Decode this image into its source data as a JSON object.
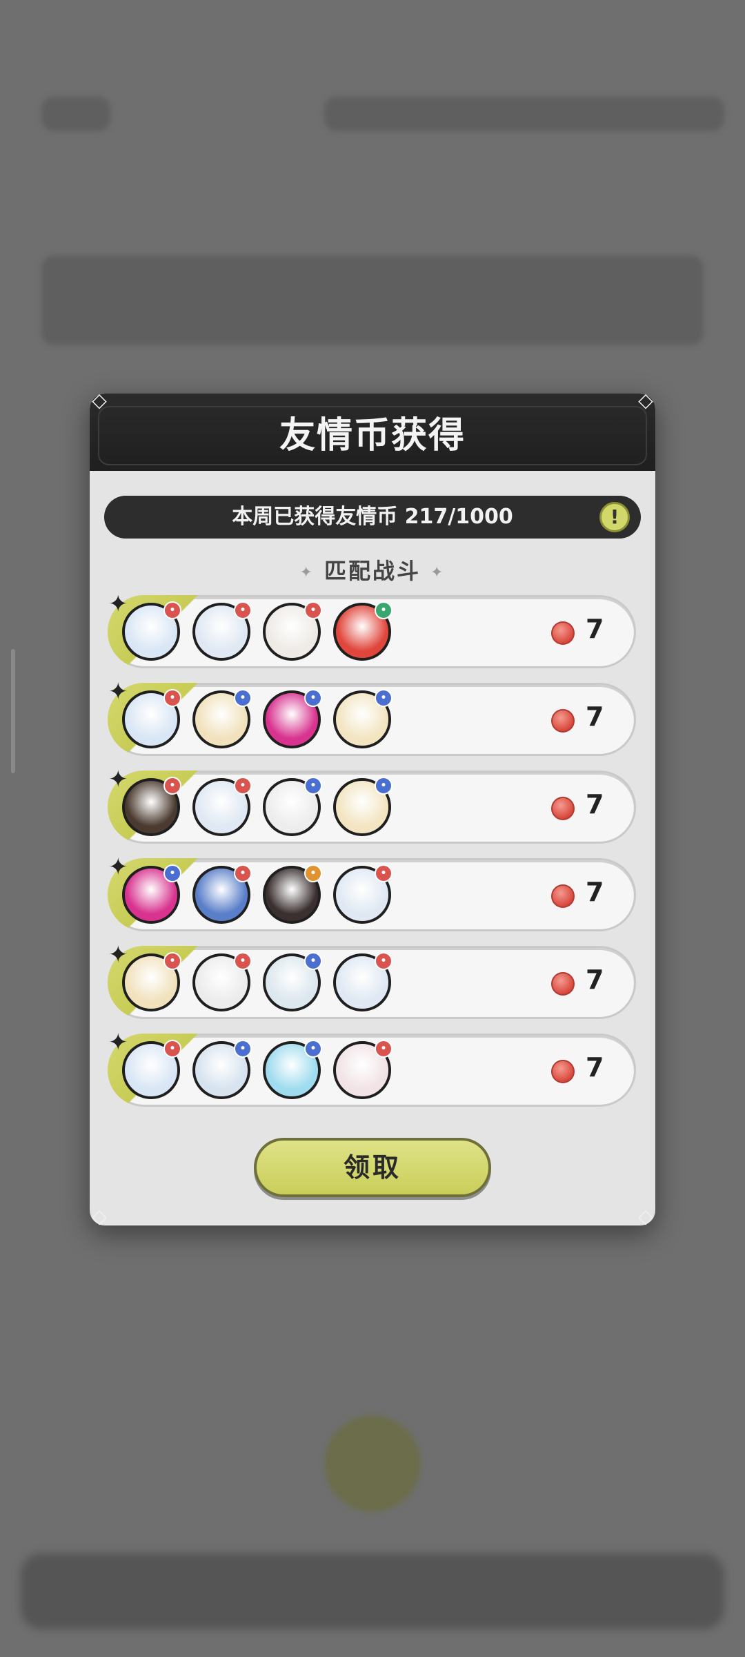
{
  "modal": {
    "title": "友情币获得",
    "weekly_text": "本周已获得友情币 217/1000",
    "info_icon": "exclamation-icon",
    "section_title": "匹配战斗",
    "claim_label": "领取",
    "rows": [
      {
        "amount": "7",
        "avatars": [
          {
            "color": "#d9e6f5",
            "badge": "#d9534f"
          },
          {
            "color": "#dfe8f3",
            "badge": "#d9534f"
          },
          {
            "color": "#eeeae6",
            "badge": "#d9534f"
          },
          {
            "color": "#e0463c",
            "badge": "#3aa66f"
          }
        ]
      },
      {
        "amount": "7",
        "avatars": [
          {
            "color": "#d9e6f5",
            "badge": "#d9534f"
          },
          {
            "color": "#f1e2bd",
            "badge": "#4a6fd0"
          },
          {
            "color": "#d8338f",
            "badge": "#4a6fd0"
          },
          {
            "color": "#f3e5c2",
            "badge": "#4a6fd0"
          }
        ]
      },
      {
        "amount": "7",
        "avatars": [
          {
            "color": "#4b3a2f",
            "badge": "#d9534f"
          },
          {
            "color": "#dfe8f3",
            "badge": "#d9534f"
          },
          {
            "color": "#ededed",
            "badge": "#4a6fd0"
          },
          {
            "color": "#f3e5c2",
            "badge": "#4a6fd0"
          }
        ]
      },
      {
        "amount": "7",
        "avatars": [
          {
            "color": "#d8338f",
            "badge": "#4a6fd0"
          },
          {
            "color": "#5a7fc9",
            "badge": "#d9534f"
          },
          {
            "color": "#3b3030",
            "badge": "#e0932f"
          },
          {
            "color": "#dfe8f3",
            "badge": "#d9534f"
          }
        ]
      },
      {
        "amount": "7",
        "avatars": [
          {
            "color": "#f1e2bd",
            "badge": "#d9534f"
          },
          {
            "color": "#ececec",
            "badge": "#d9534f"
          },
          {
            "color": "#dce7ee",
            "badge": "#4a6fd0"
          },
          {
            "color": "#dfe8f3",
            "badge": "#d9534f"
          }
        ]
      },
      {
        "amount": "7",
        "avatars": [
          {
            "color": "#d9e6f5",
            "badge": "#d9534f"
          },
          {
            "color": "#d7e3ef",
            "badge": "#4a6fd0"
          },
          {
            "color": "#9fdcef",
            "badge": "#4a6fd0"
          },
          {
            "color": "#f1e3e6",
            "badge": "#d9534f"
          }
        ]
      }
    ]
  },
  "colors": {
    "accent": "#d2d76a",
    "header_bg": "#242424",
    "coin": "#d9493d"
  }
}
